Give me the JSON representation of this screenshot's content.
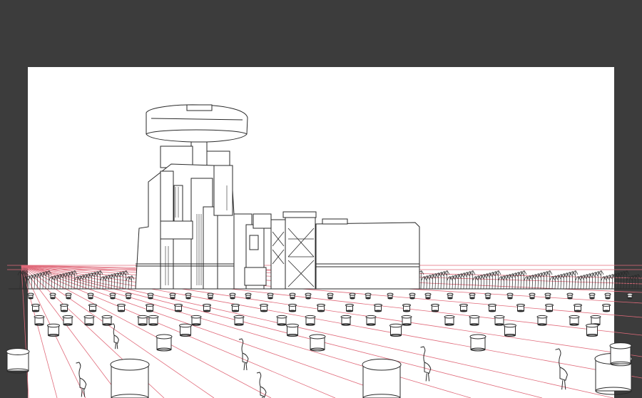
{
  "colors": {
    "workspace_bg": "#3c3c3c",
    "canvas_bg": "#ffffff",
    "ink": "#2a2a2a",
    "perspective_guide": "#e06a7a"
  },
  "scene": {
    "subject": "line-art-sketch",
    "elements": [
      "tower-building",
      "long-warehouse",
      "scaffold-structure",
      "tree-line",
      "stump-field",
      "heron-birds",
      "perspective-guides"
    ]
  }
}
